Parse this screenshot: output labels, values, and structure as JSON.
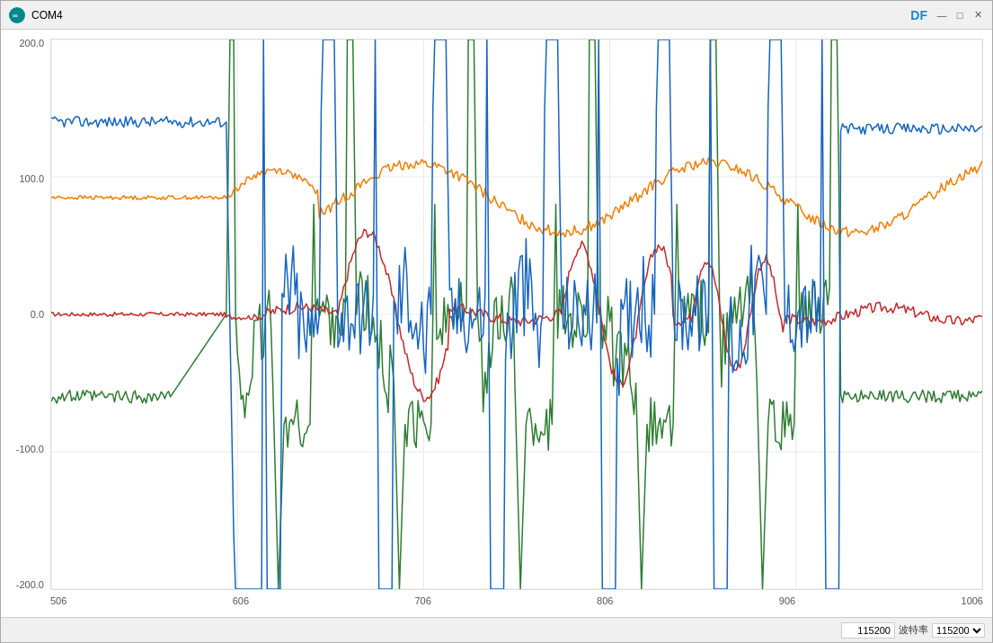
{
  "titlebar": {
    "title": "COM4",
    "df_label": "DF",
    "minimize_label": "—",
    "maximize_label": "□",
    "close_label": "✕"
  },
  "legend": {
    "colors": [
      "#1565c0",
      "#c62828",
      "#2e7d32",
      "#f57c00"
    ]
  },
  "yaxis": {
    "labels": [
      "200.0",
      "100.0",
      "0.0",
      "-100.0",
      "-200.0"
    ]
  },
  "xaxis": {
    "labels": [
      "506",
      "606",
      "706",
      "806",
      "906",
      "1006"
    ]
  },
  "bottom": {
    "baud_value": "115200",
    "baud_unit": "波特率",
    "dropdown_arrow": "∨"
  },
  "chart": {
    "series": [
      {
        "color": "#1565c0",
        "name": "blue"
      },
      {
        "color": "#c62828",
        "name": "red"
      },
      {
        "color": "#2e7d32",
        "name": "green"
      },
      {
        "color": "#f57c00",
        "name": "orange"
      }
    ]
  }
}
